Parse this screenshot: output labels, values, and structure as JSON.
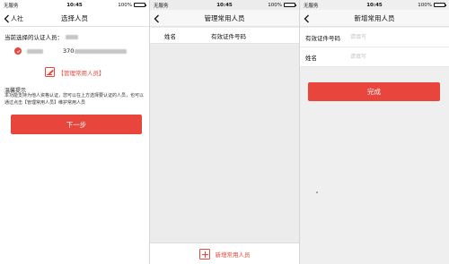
{
  "statusbar": {
    "carrier": "无服务",
    "time": "10:45",
    "battery": "100%"
  },
  "screen1": {
    "back_label": "人社",
    "title": "选择人员",
    "current_label": "当前选择的认证人员：",
    "person_id": "370",
    "manage_link": "【管理常用人员】",
    "tips_title": "温馨提示",
    "tips_text": "本功能支持为他人资格认证，您可以在上方选择要认证的人员，也可以通过点击【管理常用人员】维护常用人员",
    "next_button": "下一步"
  },
  "screen2": {
    "title": "管理常用人员",
    "col_name": "姓名",
    "col_id": "有效证件号码",
    "add_label": "新增常用人员"
  },
  "screen3": {
    "title": "新增常用人员",
    "id_label": "有效证件号码",
    "id_placeholder": "请填写",
    "name_label": "姓名",
    "name_placeholder": "请填写",
    "done_button": "完成"
  },
  "colors": {
    "accent": "#e8453c"
  }
}
